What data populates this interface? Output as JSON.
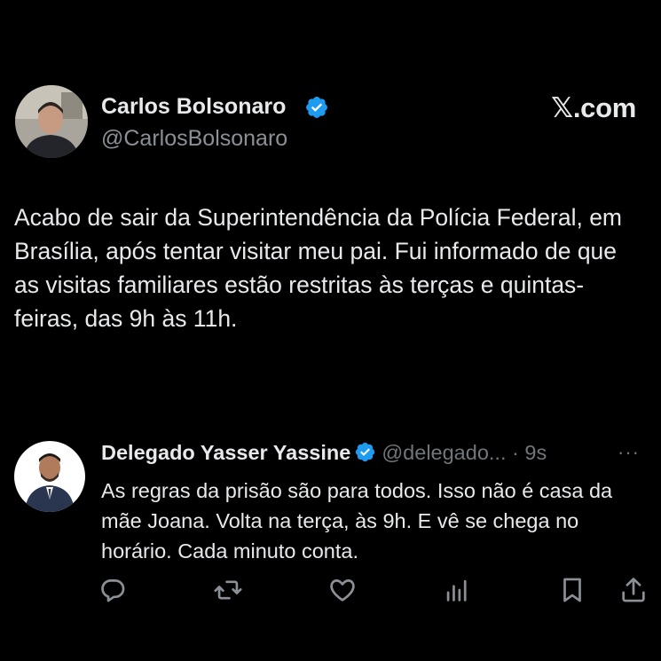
{
  "brand": {
    "logo_text": "𝕏.com"
  },
  "author": {
    "name": "Carlos Bolsonaro",
    "handle": "@CarlosBolsonaro",
    "verified": true
  },
  "tweet": {
    "text": "Acabo de sair da Superintendência da Polícia Federal, em Brasília, após tentar visitar meu pai. Fui informado de que as visitas familiares estão restritas às terças e quintas-feiras, das 9h às 11h."
  },
  "reply": {
    "name": "Delegado Yasser Yassine",
    "verified": true,
    "handle": "@delegado...",
    "separator": " · ",
    "time": "9s",
    "more": "···",
    "text": "As regras da prisão são para todos. Isso não é casa da mãe Joana. Volta na terça, às 9h. E vê se chega no horário. Cada minuto conta."
  },
  "actions": [
    "reply-icon",
    "repost-icon",
    "like-icon",
    "views-icon",
    "bookmark-icon",
    "share-icon"
  ],
  "colors": {
    "background": "#000000",
    "text": "#e7e9ea",
    "muted": "#71767b",
    "verified_badge": "#1d9bf0"
  }
}
